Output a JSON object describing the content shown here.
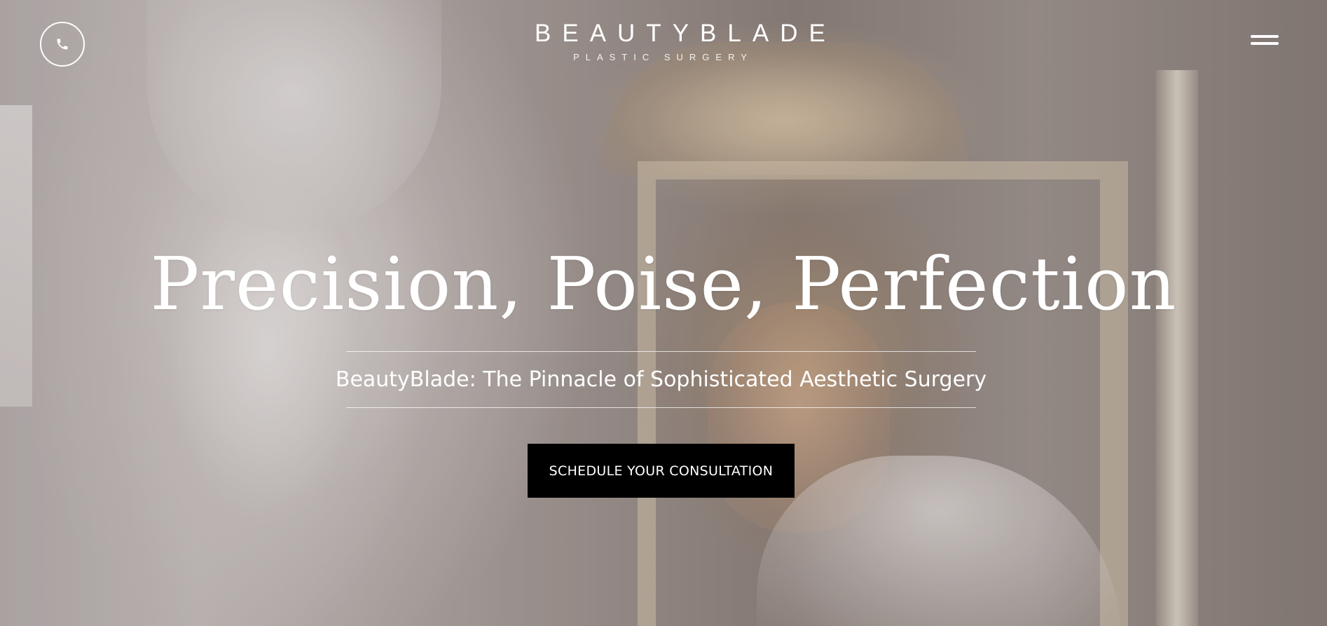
{
  "header": {
    "logo_name": "BEAUTYBLADE",
    "logo_tagline": "PLASTIC SURGERY",
    "phone_icon": "phone-icon",
    "menu_icon": "hamburger-menu-icon"
  },
  "hero": {
    "headline": "Precision, Poise, Perfection",
    "subtitle": "BeautyBlade: The Pinnacle of Sophisticated Aesthetic Surgery",
    "cta_label": "SCHEDULE YOUR CONSULTATION"
  },
  "colors": {
    "text": "#ffffff",
    "cta_background": "#000000"
  }
}
